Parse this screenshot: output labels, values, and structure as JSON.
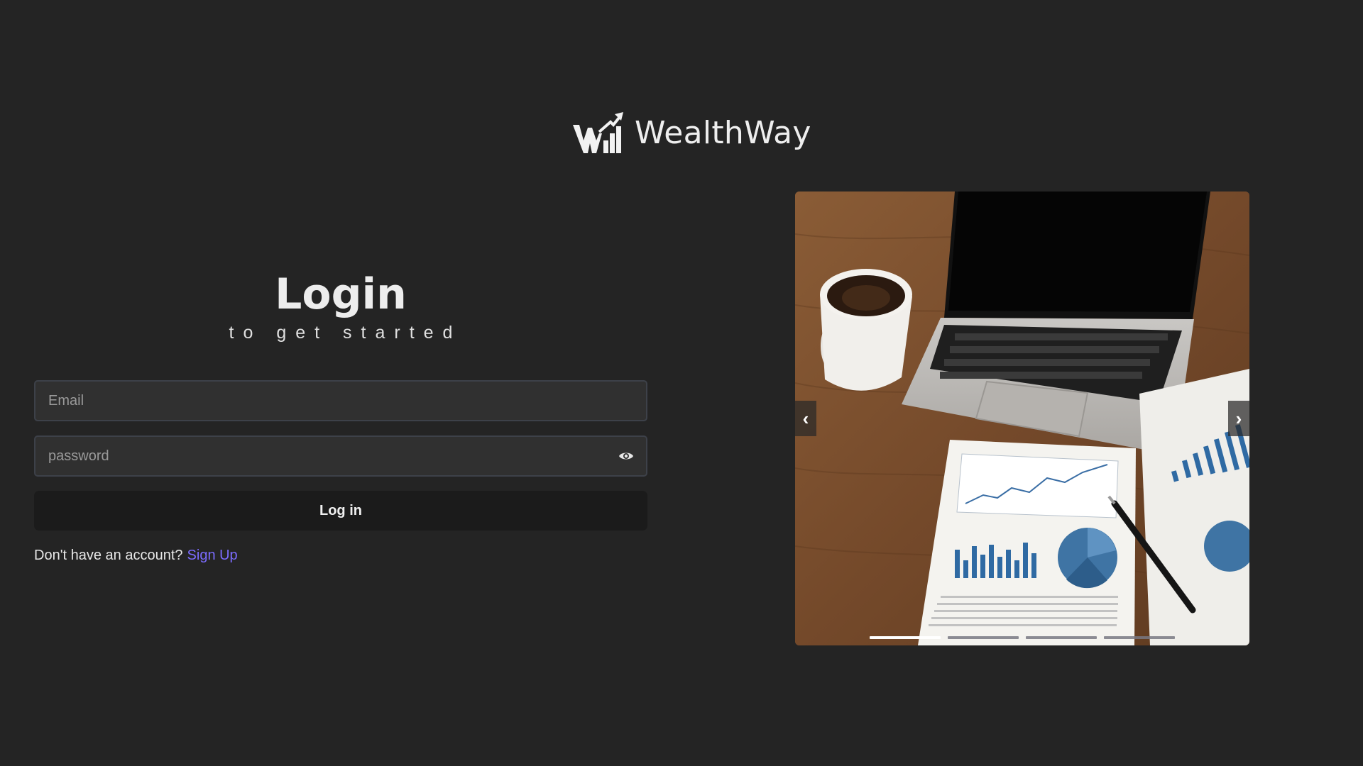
{
  "brand": {
    "name": "WealthWay",
    "logo_icon": "wealthway-logo-icon"
  },
  "login": {
    "title": "Login",
    "subtitle": "to get started",
    "email": {
      "placeholder": "Email",
      "value": ""
    },
    "password": {
      "placeholder": "password",
      "value": "",
      "toggle_icon": "eye-icon"
    },
    "submit_label": "Log in",
    "signup_prompt": "Don't have an account?",
    "signup_link": "Sign Up"
  },
  "carousel": {
    "prev_symbol": "‹",
    "next_symbol": "›",
    "slide_count": 4,
    "active_slide": 1,
    "image_subject": "laptop-coffee-financial-charts"
  },
  "colors": {
    "background": "#242424",
    "accent_link": "#7c6cff",
    "button_bg": "#1b1b1b",
    "input_bg": "#303030"
  }
}
